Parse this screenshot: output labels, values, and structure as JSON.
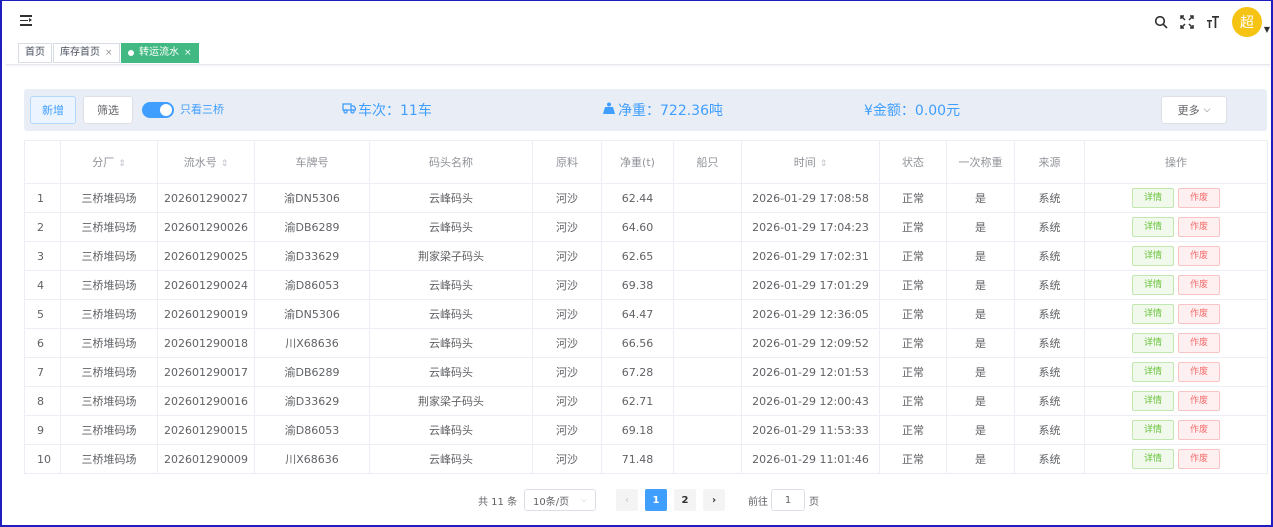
{
  "navbar": {
    "menu_icon": "hamburger-fold-icon",
    "right_icons": [
      "search-icon",
      "fullscreen-icon",
      "font-size-icon"
    ],
    "avatar_text": "超",
    "avatar_color": "#f5c313"
  },
  "tags": [
    {
      "label": "首页",
      "closable": false,
      "active": false
    },
    {
      "label": "库存首页",
      "closable": true,
      "active": false
    },
    {
      "label": "转运流水",
      "closable": true,
      "active": true
    }
  ],
  "toolbar": {
    "add_label": "新增",
    "filter_label": "筛选",
    "switch_label": "只看三桥",
    "switch_on": true,
    "more_label": "更多"
  },
  "stats": {
    "trips_icon": "truck-icon",
    "trips": "车次：11车",
    "weight_icon": "weight-icon",
    "weight": "净重：722.36吨",
    "amount": "¥金额：0.00元"
  },
  "colors": {
    "primary": "#409eff",
    "success": "#67c23a",
    "danger": "#f56c6c",
    "tag_active": "#42b983"
  },
  "table": {
    "headers": [
      "",
      "分厂",
      "流水号",
      "车牌号",
      "码头名称",
      "原料",
      "净重(t)",
      "船只",
      "时间",
      "状态",
      "一次称重",
      "来源",
      "操作"
    ],
    "sortable": [
      false,
      true,
      true,
      false,
      false,
      false,
      false,
      false,
      true,
      false,
      false,
      false,
      false
    ],
    "action_detail": "详情",
    "action_void": "作废",
    "rows": [
      [
        "1",
        "三桥堆码场",
        "202601290027",
        "渝DN5306",
        "云峰码头",
        "河沙",
        "62.44",
        "",
        "2026-01-29 17:08:58",
        "正常",
        "是",
        "系统"
      ],
      [
        "2",
        "三桥堆码场",
        "202601290026",
        "渝DB6289",
        "云峰码头",
        "河沙",
        "64.60",
        "",
        "2026-01-29 17:04:23",
        "正常",
        "是",
        "系统"
      ],
      [
        "3",
        "三桥堆码场",
        "202601290025",
        "渝D33629",
        "荆家梁子码头",
        "河沙",
        "62.65",
        "",
        "2026-01-29 17:02:31",
        "正常",
        "是",
        "系统"
      ],
      [
        "4",
        "三桥堆码场",
        "202601290024",
        "渝D86053",
        "云峰码头",
        "河沙",
        "69.38",
        "",
        "2026-01-29 17:01:29",
        "正常",
        "是",
        "系统"
      ],
      [
        "5",
        "三桥堆码场",
        "202601290019",
        "渝DN5306",
        "云峰码头",
        "河沙",
        "64.47",
        "",
        "2026-01-29 12:36:05",
        "正常",
        "是",
        "系统"
      ],
      [
        "6",
        "三桥堆码场",
        "202601290018",
        "川X68636",
        "云峰码头",
        "河沙",
        "66.56",
        "",
        "2026-01-29 12:09:52",
        "正常",
        "是",
        "系统"
      ],
      [
        "7",
        "三桥堆码场",
        "202601290017",
        "渝DB6289",
        "云峰码头",
        "河沙",
        "67.28",
        "",
        "2026-01-29 12:01:53",
        "正常",
        "是",
        "系统"
      ],
      [
        "8",
        "三桥堆码场",
        "202601290016",
        "渝D33629",
        "荆家梁子码头",
        "河沙",
        "62.71",
        "",
        "2026-01-29 12:00:43",
        "正常",
        "是",
        "系统"
      ],
      [
        "9",
        "三桥堆码场",
        "202601290015",
        "渝D86053",
        "云峰码头",
        "河沙",
        "69.18",
        "",
        "2026-01-29 11:53:33",
        "正常",
        "是",
        "系统"
      ],
      [
        "10",
        "三桥堆码场",
        "202601290009",
        "川X68636",
        "云峰码头",
        "河沙",
        "71.48",
        "",
        "2026-01-29 11:01:46",
        "正常",
        "是",
        "系统"
      ]
    ]
  },
  "pagination": {
    "total_text": "共 11 条",
    "page_size": "10条/页",
    "pages": [
      "1",
      "2"
    ],
    "current": "1",
    "goto_label": "前往",
    "goto_value": "1",
    "page_suffix": "页"
  }
}
